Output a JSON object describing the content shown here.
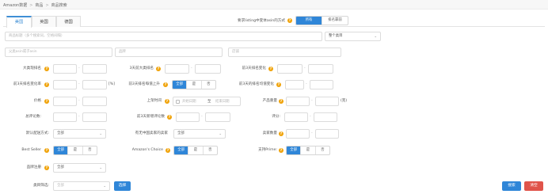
{
  "breadcrumb": [
    "Amazon数据",
    "商品",
    "商品搜索"
  ],
  "tabs": [
    {
      "label": "美国",
      "active": true
    },
    {
      "label": "英国",
      "active": false
    },
    {
      "label": "德国",
      "active": false
    }
  ],
  "listing_mode": {
    "label": "要求listing中变体asin的方式",
    "options": [
      "所有",
      "排名靠前"
    ],
    "selected": "所有"
  },
  "search": {
    "placeholder": "商品标题（多个搜索词，空格间隔）",
    "scope": "整个类目"
  },
  "filters_row2": {
    "asin_placeholder": "父类asin或子asin",
    "brand_placeholder": "品牌",
    "seller_placeholder": "店铺"
  },
  "rows": {
    "big_rank": "大类现排名",
    "day3_big_rank": "3天前大类排名",
    "day3_rank_change": "前3天排名变化",
    "day3_rank_rate": "前3天排名变化率",
    "rank_rate_unit": "[%]",
    "day3_rank_rise": "前3天排名每值上升",
    "day3_avg_rank_change": "前3天的排名均值变化",
    "price": "价格",
    "launch_date": "上架时间",
    "start_placeholder": "开始日期",
    "date_sep": "至",
    "end_placeholder": "结束日期",
    "weight": "产品重量",
    "weight_unit": "(克)",
    "total_reviews": "总评论数:",
    "day3_new_reviews": "前3天新增评论数",
    "rating": "评分:",
    "delivery": "默认配送方式:",
    "delivery_value": "全部",
    "cn_seller": "有无中国卖家的卖家",
    "cn_seller_value": "全部",
    "seller_count": "卖家数量",
    "best_seller": "Best Seller",
    "amazon_choice": "Amazon's Choice",
    "prime": "支持Prime:",
    "brand_reg": "品牌注册",
    "brand_reg_value": "全部",
    "category": "类目筛选:",
    "category_value": "全部",
    "choose": "选择"
  },
  "seg_options": [
    "全部",
    "是",
    "否"
  ],
  "seg_selected": "全部",
  "actions": {
    "search": "搜索",
    "clear": "清空"
  },
  "dash": "-",
  "help_glyph": "?",
  "chevron": "⌄",
  "colors": {
    "primary": "#2f86d8",
    "danger": "#e0544a",
    "help": "#f0a30a"
  }
}
